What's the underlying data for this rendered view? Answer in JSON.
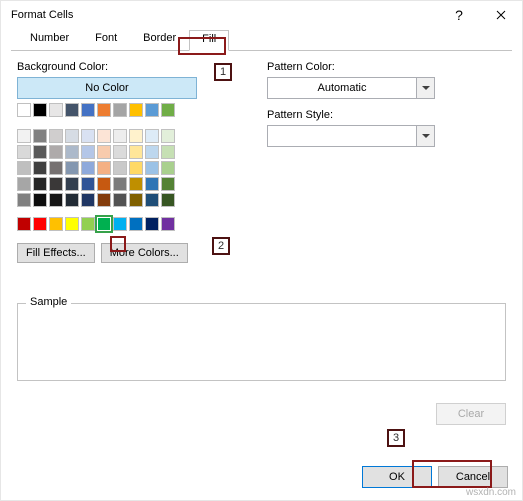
{
  "window": {
    "title": "Format Cells"
  },
  "tabs": [
    "Number",
    "Font",
    "Border",
    "Fill"
  ],
  "labels": {
    "bgColor": "Background Color:",
    "noColor": "No Color",
    "patternColor": "Pattern Color:",
    "patternStyle": "Pattern Style:",
    "sample": "Sample"
  },
  "dropdowns": {
    "patternColor": "Automatic",
    "patternStyle": ""
  },
  "buttons": {
    "fillEffects": "Fill Effects...",
    "moreColors": "More Colors...",
    "clear": "Clear",
    "ok": "OK",
    "cancel": "Cancel"
  },
  "annotations": {
    "a1": "1",
    "a2": "2",
    "a3": "3"
  },
  "palette": {
    "row1": [
      "#FFFFFF",
      "#000000",
      "#E7E6E6",
      "#44546A",
      "#4472C4",
      "#ED7D31",
      "#A5A5A5",
      "#FFC000",
      "#5B9BD5",
      "#70AD47"
    ],
    "theme": [
      [
        "#F2F2F2",
        "#808080",
        "#D0CECE",
        "#D6DCE4",
        "#D9E1F2",
        "#FCE4D6",
        "#EDEDED",
        "#FFF2CC",
        "#DDEBF7",
        "#E2EFDA"
      ],
      [
        "#D9D9D9",
        "#595959",
        "#AEAAAA",
        "#ACB9CA",
        "#B4C6E7",
        "#F8CBAD",
        "#DBDBDB",
        "#FFE699",
        "#BDD7EE",
        "#C6E0B4"
      ],
      [
        "#BFBFBF",
        "#404040",
        "#767171",
        "#8497B0",
        "#8EA9DB",
        "#F4B084",
        "#C9C9C9",
        "#FFD966",
        "#9BC2E6",
        "#A9D08E"
      ],
      [
        "#A6A6A6",
        "#262626",
        "#3A3838",
        "#333F4F",
        "#305496",
        "#C65911",
        "#7B7B7B",
        "#BF8F00",
        "#2F75B5",
        "#548235"
      ],
      [
        "#808080",
        "#0D0D0D",
        "#161616",
        "#222B35",
        "#203764",
        "#833C0C",
        "#525252",
        "#806000",
        "#1F4E78",
        "#375623"
      ]
    ],
    "standard": [
      "#C00000",
      "#FF0000",
      "#FFC000",
      "#FFFF00",
      "#92D050",
      "#00B050",
      "#00B0F0",
      "#0070C0",
      "#002060",
      "#7030A0"
    ],
    "selected": "#00B050"
  },
  "watermark": "wsxdn.com"
}
